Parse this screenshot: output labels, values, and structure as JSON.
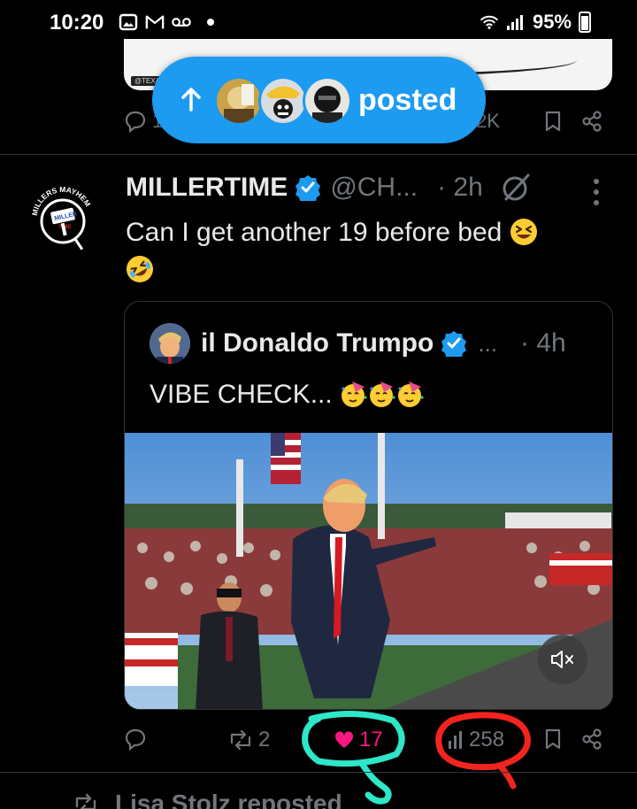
{
  "status_bar": {
    "time": "10:20",
    "battery": "95%"
  },
  "prev_tweet": {
    "reply_count_partial": "1",
    "views_partial": "2K",
    "media_tag": "@TEXAS"
  },
  "new_posts_pill": {
    "label": "posted"
  },
  "tweet": {
    "display_name": "MILLERTIME",
    "handle": "@CH...",
    "time": "· 2h",
    "text_line1": "Can I get another 19 before bed",
    "avatar_label": "MILLERTIME",
    "quoted": {
      "display_name": "il Donaldo Trumpo",
      "ellipsis": "...",
      "time": "· 4h",
      "text": "VIBE CHECK..."
    },
    "actions": {
      "replies": "",
      "reposts": "2",
      "likes": "17",
      "views": "258"
    }
  },
  "next_item": {
    "repost_label": "Lisa Stolz reposted"
  },
  "colors": {
    "accent": "#1d9bf0",
    "like": "#f91880",
    "muted": "#71767b",
    "annotation_teal": "#2ee6c8",
    "annotation_red": "#f2241f"
  }
}
